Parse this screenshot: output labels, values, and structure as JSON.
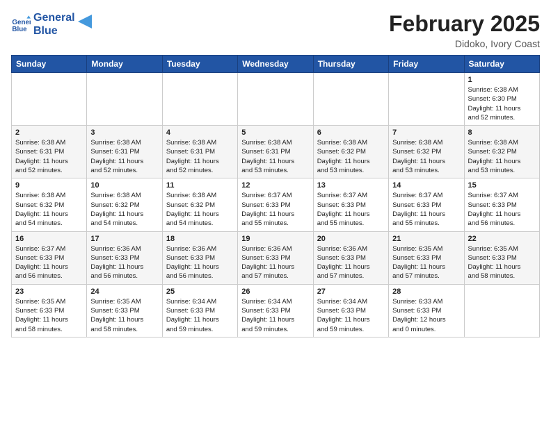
{
  "logo": {
    "line1": "General",
    "line2": "Blue"
  },
  "title": "February 2025",
  "location": "Didoko, Ivory Coast",
  "days_of_week": [
    "Sunday",
    "Monday",
    "Tuesday",
    "Wednesday",
    "Thursday",
    "Friday",
    "Saturday"
  ],
  "weeks": [
    [
      {
        "day": "",
        "info": ""
      },
      {
        "day": "",
        "info": ""
      },
      {
        "day": "",
        "info": ""
      },
      {
        "day": "",
        "info": ""
      },
      {
        "day": "",
        "info": ""
      },
      {
        "day": "",
        "info": ""
      },
      {
        "day": "1",
        "info": "Sunrise: 6:38 AM\nSunset: 6:30 PM\nDaylight: 11 hours\nand 52 minutes."
      }
    ],
    [
      {
        "day": "2",
        "info": "Sunrise: 6:38 AM\nSunset: 6:31 PM\nDaylight: 11 hours\nand 52 minutes."
      },
      {
        "day": "3",
        "info": "Sunrise: 6:38 AM\nSunset: 6:31 PM\nDaylight: 11 hours\nand 52 minutes."
      },
      {
        "day": "4",
        "info": "Sunrise: 6:38 AM\nSunset: 6:31 PM\nDaylight: 11 hours\nand 52 minutes."
      },
      {
        "day": "5",
        "info": "Sunrise: 6:38 AM\nSunset: 6:31 PM\nDaylight: 11 hours\nand 53 minutes."
      },
      {
        "day": "6",
        "info": "Sunrise: 6:38 AM\nSunset: 6:32 PM\nDaylight: 11 hours\nand 53 minutes."
      },
      {
        "day": "7",
        "info": "Sunrise: 6:38 AM\nSunset: 6:32 PM\nDaylight: 11 hours\nand 53 minutes."
      },
      {
        "day": "8",
        "info": "Sunrise: 6:38 AM\nSunset: 6:32 PM\nDaylight: 11 hours\nand 53 minutes."
      }
    ],
    [
      {
        "day": "9",
        "info": "Sunrise: 6:38 AM\nSunset: 6:32 PM\nDaylight: 11 hours\nand 54 minutes."
      },
      {
        "day": "10",
        "info": "Sunrise: 6:38 AM\nSunset: 6:32 PM\nDaylight: 11 hours\nand 54 minutes."
      },
      {
        "day": "11",
        "info": "Sunrise: 6:38 AM\nSunset: 6:32 PM\nDaylight: 11 hours\nand 54 minutes."
      },
      {
        "day": "12",
        "info": "Sunrise: 6:37 AM\nSunset: 6:33 PM\nDaylight: 11 hours\nand 55 minutes."
      },
      {
        "day": "13",
        "info": "Sunrise: 6:37 AM\nSunset: 6:33 PM\nDaylight: 11 hours\nand 55 minutes."
      },
      {
        "day": "14",
        "info": "Sunrise: 6:37 AM\nSunset: 6:33 PM\nDaylight: 11 hours\nand 55 minutes."
      },
      {
        "day": "15",
        "info": "Sunrise: 6:37 AM\nSunset: 6:33 PM\nDaylight: 11 hours\nand 56 minutes."
      }
    ],
    [
      {
        "day": "16",
        "info": "Sunrise: 6:37 AM\nSunset: 6:33 PM\nDaylight: 11 hours\nand 56 minutes."
      },
      {
        "day": "17",
        "info": "Sunrise: 6:36 AM\nSunset: 6:33 PM\nDaylight: 11 hours\nand 56 minutes."
      },
      {
        "day": "18",
        "info": "Sunrise: 6:36 AM\nSunset: 6:33 PM\nDaylight: 11 hours\nand 56 minutes."
      },
      {
        "day": "19",
        "info": "Sunrise: 6:36 AM\nSunset: 6:33 PM\nDaylight: 11 hours\nand 57 minutes."
      },
      {
        "day": "20",
        "info": "Sunrise: 6:36 AM\nSunset: 6:33 PM\nDaylight: 11 hours\nand 57 minutes."
      },
      {
        "day": "21",
        "info": "Sunrise: 6:35 AM\nSunset: 6:33 PM\nDaylight: 11 hours\nand 57 minutes."
      },
      {
        "day": "22",
        "info": "Sunrise: 6:35 AM\nSunset: 6:33 PM\nDaylight: 11 hours\nand 58 minutes."
      }
    ],
    [
      {
        "day": "23",
        "info": "Sunrise: 6:35 AM\nSunset: 6:33 PM\nDaylight: 11 hours\nand 58 minutes."
      },
      {
        "day": "24",
        "info": "Sunrise: 6:35 AM\nSunset: 6:33 PM\nDaylight: 11 hours\nand 58 minutes."
      },
      {
        "day": "25",
        "info": "Sunrise: 6:34 AM\nSunset: 6:33 PM\nDaylight: 11 hours\nand 59 minutes."
      },
      {
        "day": "26",
        "info": "Sunrise: 6:34 AM\nSunset: 6:33 PM\nDaylight: 11 hours\nand 59 minutes."
      },
      {
        "day": "27",
        "info": "Sunrise: 6:34 AM\nSunset: 6:33 PM\nDaylight: 11 hours\nand 59 minutes."
      },
      {
        "day": "28",
        "info": "Sunrise: 6:33 AM\nSunset: 6:33 PM\nDaylight: 12 hours\nand 0 minutes."
      },
      {
        "day": "",
        "info": ""
      }
    ]
  ]
}
